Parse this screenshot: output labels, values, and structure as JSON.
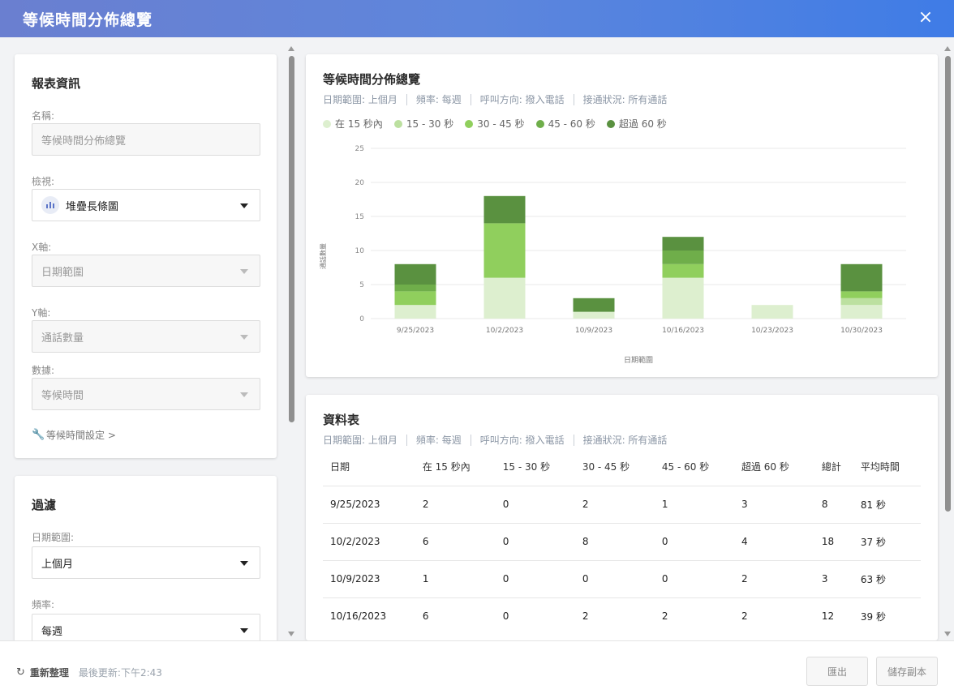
{
  "window": {
    "title": "等候時間分佈總覽",
    "close_icon": "×"
  },
  "report_info": {
    "heading": "報表資訊",
    "name": {
      "label": "名稱:",
      "value": "等候時間分佈總覽"
    },
    "view": {
      "label": "檢視:",
      "value": "堆疊長條圖"
    },
    "x_axis": {
      "label": "X軸:",
      "value": "日期範圍"
    },
    "y_axis": {
      "label": "Y軸:",
      "value": "通話數量"
    },
    "data": {
      "label": "數據:",
      "value": "等候時間"
    },
    "settings_link": "等候時間設定 >"
  },
  "filter": {
    "heading": "過濾",
    "date_range": {
      "label": "日期範圍:",
      "value": "上個月"
    },
    "frequency": {
      "label": "頻率:",
      "value": "每週"
    }
  },
  "chart_card": {
    "title": "等候時間分佈總覽",
    "meta": [
      "日期範圍: 上個月",
      "頻率: 每週",
      "呼叫方向: 撥入電話",
      "接通狀況: 所有通話"
    ]
  },
  "chart_data": {
    "type": "bar",
    "stacked": true,
    "categories": [
      "9/25/2023",
      "10/2/2023",
      "10/9/2023",
      "10/16/2023",
      "10/23/2023",
      "10/30/2023"
    ],
    "series": [
      {
        "name": "在 15 秒內",
        "color": "#ddefcf",
        "values": [
          2,
          6,
          1,
          6,
          2,
          2
        ]
      },
      {
        "name": "15 - 30 秒",
        "color": "#bce0a0",
        "values": [
          0,
          0,
          0,
          0,
          0,
          1
        ]
      },
      {
        "name": "30 - 45 秒",
        "color": "#90cf5d",
        "values": [
          2,
          8,
          0,
          2,
          0,
          1
        ]
      },
      {
        "name": "45 - 60 秒",
        "color": "#6fae4a",
        "values": [
          1,
          0,
          0,
          2,
          0,
          0
        ]
      },
      {
        "name": "超過 60 秒",
        "color": "#5a9140",
        "values": [
          3,
          4,
          2,
          2,
          0,
          4
        ]
      }
    ],
    "xlabel": "日期範圍",
    "ylabel": "通話數量",
    "ylim": [
      0,
      25
    ],
    "yticks": [
      0,
      5,
      10,
      15,
      20,
      25
    ],
    "grid": true,
    "legend": "top-left"
  },
  "table_card": {
    "title": "資料表",
    "meta": [
      "日期範圍: 上個月",
      "頻率: 每週",
      "呼叫方向: 撥入電話",
      "接通狀況: 所有通話"
    ],
    "columns": [
      "日期",
      "在 15 秒內",
      "15 - 30 秒",
      "30 - 45 秒",
      "45 - 60 秒",
      "超過 60 秒",
      "總計",
      "平均時間"
    ],
    "rows": [
      [
        "9/25/2023",
        "2",
        "0",
        "2",
        "1",
        "3",
        "8",
        "81 秒"
      ],
      [
        "10/2/2023",
        "6",
        "0",
        "8",
        "0",
        "4",
        "18",
        "37 秒"
      ],
      [
        "10/9/2023",
        "1",
        "0",
        "0",
        "0",
        "2",
        "3",
        "63 秒"
      ],
      [
        "10/16/2023",
        "6",
        "0",
        "2",
        "2",
        "2",
        "12",
        "39 秒"
      ]
    ]
  },
  "footer": {
    "refresh_label": "重新整理",
    "last_updated": "最後更新:下午2:43",
    "export_label": "匯出",
    "save_copy_label": "儲存副本"
  }
}
